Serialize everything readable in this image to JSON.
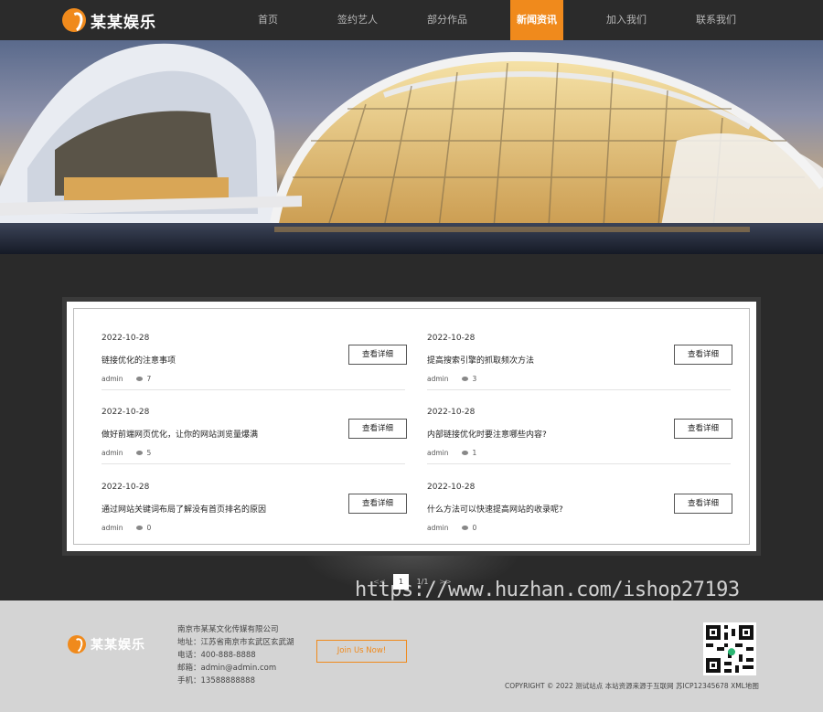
{
  "brand": {
    "name": "某某娱乐"
  },
  "nav": [
    {
      "label": "首页"
    },
    {
      "label": "签约艺人"
    },
    {
      "label": "部分作品"
    },
    {
      "label": "新闻资讯",
      "active": true
    },
    {
      "label": "加入我们"
    },
    {
      "label": "联系我们"
    }
  ],
  "news": [
    {
      "date": "2022-10-28",
      "title": "链接优化的注意事项",
      "author": "admin",
      "views": "7",
      "button": "查看详细"
    },
    {
      "date": "2022-10-28",
      "title": "提高搜索引擎的抓取频次方法",
      "author": "admin",
      "views": "3",
      "button": "查看详细"
    },
    {
      "date": "2022-10-28",
      "title": "做好前端网页优化，让你的网站浏览量爆满",
      "author": "admin",
      "views": "5",
      "button": "查看详细"
    },
    {
      "date": "2022-10-28",
      "title": "内部链接优化时要注意哪些内容?",
      "author": "admin",
      "views": "1",
      "button": "查看详细"
    },
    {
      "date": "2022-10-28",
      "title": "通过网站关键词布局了解没有首页排名的原因",
      "author": "admin",
      "views": "0",
      "button": "查看详细"
    },
    {
      "date": "2022-10-28",
      "title": "什么方法可以快速提高网站的收录呢?",
      "author": "admin",
      "views": "0",
      "button": "查看详细"
    }
  ],
  "pagination": {
    "prev": "<<",
    "current": "1",
    "count": "1/1",
    "next": ">>"
  },
  "watermark": "https://www.huzhan.com/ishop27193",
  "footer": {
    "company": "南京市某某文化传媒有限公司",
    "address": "地址：江苏省南京市玄武区玄武湖",
    "phone": "电话：400-888-8888",
    "email": "邮箱：admin@admin.com",
    "mobile": "手机：13588888888",
    "join_label": "Join Us Now!",
    "copyright": "COPYRIGHT © 2022 测试站点 本站资源来源于互联网 苏ICP12345678 XML地图"
  },
  "colors": {
    "accent": "#f08a1c",
    "header": "#2b2b2b",
    "footer": "#d4d4d4"
  }
}
